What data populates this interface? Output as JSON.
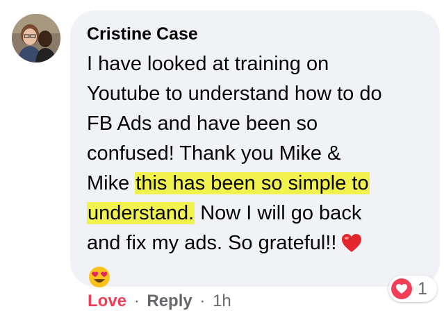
{
  "comment": {
    "author": "Cristine Case",
    "lines": {
      "l1": "I have looked at training on",
      "l2": "Youtube to understand how to do",
      "l3": "FB Ads and have been so",
      "l4": "confused! Thank you Mike &",
      "l5_pre": "Mike ",
      "l5_hl": "this has been so simple to",
      "l6_hl": "understand.",
      "l6_post": " Now I will go back",
      "l7": "and fix my ads. So grateful!!"
    },
    "highlight_color": "#f1f24e",
    "inline_icons": [
      "heart-icon",
      "heart-eyes-icon"
    ]
  },
  "reactions": {
    "icon": "love-reaction-icon",
    "count": "1"
  },
  "actions": {
    "love": "Love",
    "separator": "·",
    "reply": "Reply",
    "time": "1h"
  },
  "colors": {
    "bubble": "#f0f2f5",
    "love": "#f33e58",
    "meta": "#65676b"
  }
}
